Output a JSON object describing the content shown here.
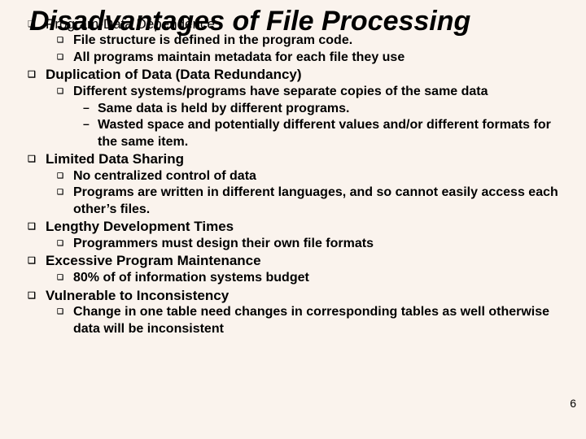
{
  "title": "Disadvantages of File Processing",
  "page_number": "6",
  "bullets": {
    "b1": "Program-Data Dependence",
    "b1a": "File structure is defined in the program code.",
    "b1b": "All programs maintain metadata for each file they use",
    "b2": "Duplication of Data (Data Redundancy)",
    "b2a": "Different systems/programs have separate copies of the same data",
    "b2a1": "Same data is held by different programs.",
    "b2a2": "Wasted space and potentially different values and/or different formats for the same item.",
    "b3": "Limited Data Sharing",
    "b3a": "No centralized control of data",
    "b3b": "Programs are written in different languages, and so cannot easily access each other’s files.",
    "b4": "Lengthy Development Times",
    "b4a": "Programmers must design their own file formats",
    "b5": "Excessive Program Maintenance",
    "b5a": "80% of of information systems budget",
    "b6": "Vulnerable to Inconsistency",
    "b6a": "Change in one table need changes in corresponding tables as well otherwise data will be inconsistent"
  }
}
